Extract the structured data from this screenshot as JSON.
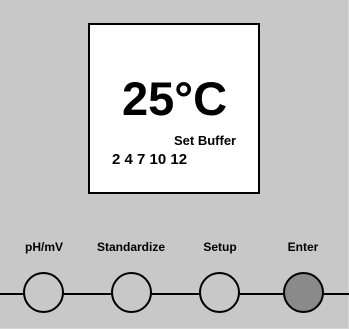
{
  "display": {
    "temperature": "25°C",
    "mode_label": "Set Buffer",
    "buffer_values": "2 4 7 10 12"
  },
  "buttons": [
    {
      "label": "pH/mV",
      "active": false
    },
    {
      "label": "Standardize",
      "active": false
    },
    {
      "label": "Setup",
      "active": false
    },
    {
      "label": "Enter",
      "active": true
    }
  ],
  "colors": {
    "panel": "#c8c8c8",
    "screen": "#ffffff",
    "active_button": "#8a8a8a"
  }
}
